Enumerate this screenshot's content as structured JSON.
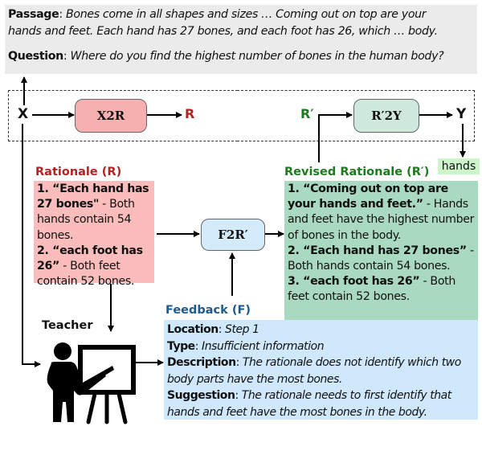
{
  "passage": {
    "label": "Passage",
    "text_line1": "Bones come in all shapes and sizes … Coming out on top are your",
    "text_line2": "hands and feet. Each hand has 27 bones, and each foot has 26, which … body."
  },
  "question": {
    "label": "Question",
    "text": "Where do you find the highest number of bones in the human body?"
  },
  "nodes": {
    "x": "X",
    "x2r": "X2R",
    "r": "R",
    "r_prime": "R′",
    "r2y": "R′2Y",
    "y": "Y",
    "answer": "hands",
    "f2r": "F2R′",
    "teacher": "Teacher"
  },
  "rationale": {
    "title": "Rationale (R)",
    "items": [
      {
        "quote": "1. “Each hand has 27 bones\"",
        "text": " - Both hands contain 54 bones."
      },
      {
        "quote": "2. “each foot has 26”",
        "text": " - Both feet contain 52 bones."
      }
    ]
  },
  "revised_rationale": {
    "title": "Revised Rationale (R′)",
    "items": [
      {
        "quote": "1. “Coming out on top are your hands and feet.”",
        "text": " - Hands and feet have the highest number of bones in the body."
      },
      {
        "quote": "2. “Each hand has 27 bones”",
        "text": " - Both hands contain 54 bones."
      },
      {
        "quote": "3. “each foot has 26”",
        "text": " - Both feet contain 52 bones."
      }
    ]
  },
  "feedback": {
    "title": "Feedback (F)",
    "fields": [
      {
        "label": "Location",
        "value": "Step 1"
      },
      {
        "label": "Type",
        "value": "Insufficient information"
      },
      {
        "label": "Description",
        "value": "The rationale does not identify which two body parts have the most bones."
      },
      {
        "label": "Suggestion",
        "value": "The rationale needs to first identify that hands and feet have the most bones in the body."
      }
    ]
  },
  "colors": {
    "rationale_red": "#b22222",
    "revised_green": "#1e7a1e",
    "feedback_blue": "#1f5a8c",
    "rationale_fill": "#fbbcbc",
    "revised_fill": "#a9d9c0",
    "feedback_fill": "#cfe8fb",
    "x2r_fill": "#f6b0b0",
    "r2y_fill": "#cfe8dc",
    "f2r_fill": "#d3ebfb",
    "answer_fill": "#ccf5cc"
  }
}
